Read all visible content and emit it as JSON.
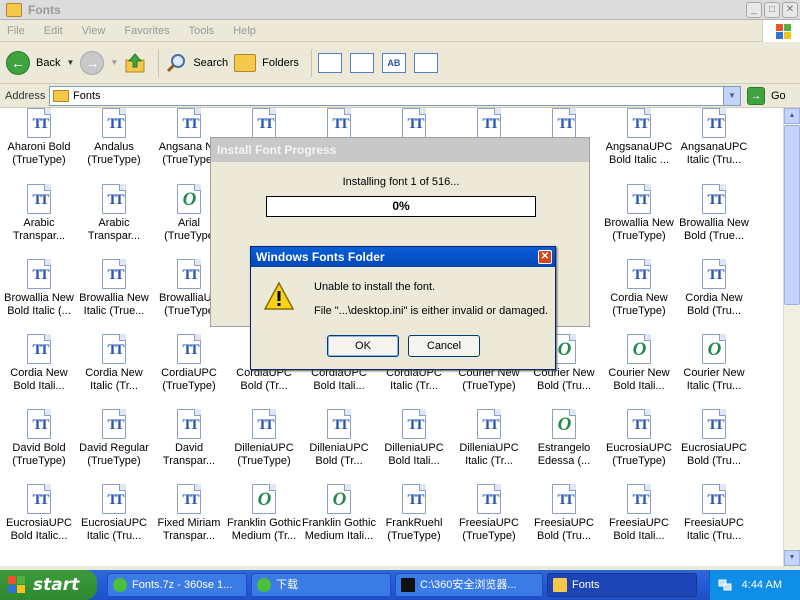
{
  "window": {
    "title": "Fonts",
    "buttons": {
      "minimize": "_",
      "maximize": "□",
      "close": "✕"
    }
  },
  "menu": [
    "File",
    "Edit",
    "View",
    "Favorites",
    "Tools",
    "Help"
  ],
  "toolbar": {
    "back_label": "Back",
    "search_label": "Search",
    "folders_label": "Folders",
    "views": [
      "thumbnails-view",
      "large-icons-view",
      "details-view",
      "list-view"
    ],
    "view_glyphs": [
      "",
      "",
      "AB",
      ""
    ]
  },
  "address": {
    "label": "Address",
    "value": "Fonts",
    "go_label": "Go"
  },
  "fonts": [
    {
      "name": "Aharoni Bold",
      "type": "(TrueType)",
      "kind": "tt"
    },
    {
      "name": "Andalus",
      "type": "(TrueType)",
      "kind": "tt"
    },
    {
      "name": "Angsana Ne",
      "type": "(TrueType)",
      "kind": "tt"
    },
    {
      "name": "",
      "type": "",
      "kind": "tt"
    },
    {
      "name": "",
      "type": "",
      "kind": "tt"
    },
    {
      "name": "",
      "type": "",
      "kind": "tt"
    },
    {
      "name": "",
      "type": "",
      "kind": "tt"
    },
    {
      "name": "UPC",
      "type": "",
      "kind": "tt"
    },
    {
      "name": "AngsanaUPC",
      "type": "Bold Italic ...",
      "kind": "tt"
    },
    {
      "name": "AngsanaUPC",
      "type": "Italic (Tru...",
      "kind": "tt"
    },
    {
      "name": "Arabic",
      "type": "Transpar...",
      "kind": "tt"
    },
    {
      "name": "Arabic",
      "type": "Transpar...",
      "kind": "tt"
    },
    {
      "name": "Arial",
      "type": "(TrueType",
      "kind": "ot"
    },
    {
      "name": "",
      "type": "",
      "kind": "tt"
    },
    {
      "name": "",
      "type": "",
      "kind": "tt"
    },
    {
      "name": "",
      "type": "",
      "kind": "tt"
    },
    {
      "name": "",
      "type": "",
      "kind": "tt"
    },
    {
      "name": "",
      "type": "",
      "kind": "tt"
    },
    {
      "name": "Browallia New",
      "type": "(TrueType)",
      "kind": "tt"
    },
    {
      "name": "Browallia New",
      "type": "Bold (True...",
      "kind": "tt"
    },
    {
      "name": "Browallia New",
      "type": "Bold Italic (...",
      "kind": "tt"
    },
    {
      "name": "Browallia New",
      "type": "Italic (True...",
      "kind": "tt"
    },
    {
      "name": "BrowalliaUP",
      "type": "(TrueType",
      "kind": "tt"
    },
    {
      "name": "",
      "type": "",
      "kind": "tt"
    },
    {
      "name": "",
      "type": "",
      "kind": "tt"
    },
    {
      "name": "",
      "type": "",
      "kind": "tt"
    },
    {
      "name": "",
      "type": "",
      "kind": "tt"
    },
    {
      "name": "MS",
      "type": "",
      "kind": "tt"
    },
    {
      "name": "Cordia New",
      "type": "(TrueType)",
      "kind": "tt"
    },
    {
      "name": "Cordia New",
      "type": "Bold (Tru...",
      "kind": "tt"
    },
    {
      "name": "Cordia New",
      "type": "Bold Itali...",
      "kind": "tt"
    },
    {
      "name": "Cordia New",
      "type": "Italic (Tr...",
      "kind": "tt"
    },
    {
      "name": "CordiaUPC",
      "type": "(TrueType)",
      "kind": "tt"
    },
    {
      "name": "CordiaUPC",
      "type": "Bold (Tr...",
      "kind": "tt"
    },
    {
      "name": "CordiaUPC",
      "type": "Bold Itali...",
      "kind": "tt"
    },
    {
      "name": "CordiaUPC",
      "type": "Italic (Tr...",
      "kind": "tt"
    },
    {
      "name": "Courier New",
      "type": "(TrueType)",
      "kind": "ot"
    },
    {
      "name": "Courier New",
      "type": "Bold (Tru...",
      "kind": "ot"
    },
    {
      "name": "Courier New",
      "type": "Bold Itali...",
      "kind": "ot"
    },
    {
      "name": "Courier New",
      "type": "Italic (Tru...",
      "kind": "ot"
    },
    {
      "name": "David Bold",
      "type": "(TrueType)",
      "kind": "tt"
    },
    {
      "name": "David Regular",
      "type": "(TrueType)",
      "kind": "tt"
    },
    {
      "name": "David",
      "type": "Transpar...",
      "kind": "tt"
    },
    {
      "name": "DilleniaUPC",
      "type": "(TrueType)",
      "kind": "tt"
    },
    {
      "name": "DilleniaUPC",
      "type": "Bold (Tr...",
      "kind": "tt"
    },
    {
      "name": "DilleniaUPC",
      "type": "Bold Itali...",
      "kind": "tt"
    },
    {
      "name": "DilleniaUPC",
      "type": "Italic (Tr...",
      "kind": "tt"
    },
    {
      "name": "Estrangelo",
      "type": "Edessa (...",
      "kind": "ot"
    },
    {
      "name": "EucrosiaUPC",
      "type": "(TrueType)",
      "kind": "tt"
    },
    {
      "name": "EucrosiaUPC",
      "type": "Bold (Tru...",
      "kind": "tt"
    },
    {
      "name": "EucrosiaUPC",
      "type": "Bold Italic...",
      "kind": "tt"
    },
    {
      "name": "EucrosiaUPC",
      "type": "Italic (Tru...",
      "kind": "tt"
    },
    {
      "name": "Fixed Miriam",
      "type": "Transpar...",
      "kind": "tt"
    },
    {
      "name": "Franklin Gothic",
      "type": "Medium (Tr...",
      "kind": "ot"
    },
    {
      "name": "Franklin Gothic",
      "type": "Medium Itali...",
      "kind": "ot"
    },
    {
      "name": "FrankRuehl",
      "type": "(TrueType)",
      "kind": "tt"
    },
    {
      "name": "FreesiaUPC",
      "type": "(TrueType)",
      "kind": "tt"
    },
    {
      "name": "FreesiaUPC",
      "type": "Bold (Tru...",
      "kind": "tt"
    },
    {
      "name": "FreesiaUPC",
      "type": "Bold Itali...",
      "kind": "tt"
    },
    {
      "name": "FreesiaUPC",
      "type": "Italic (Tru...",
      "kind": "tt"
    }
  ],
  "progress_dialog": {
    "title": "Install Font Progress",
    "text": "Installing font 1 of 516...",
    "percent_label": "0%",
    "percent": 0
  },
  "error_dialog": {
    "title": "Windows Fonts Folder",
    "close": "✕",
    "line1": "Unable to install the font.",
    "line2": "File \"...\\desktop.ini\" is either invalid or damaged.",
    "ok_label": "OK",
    "cancel_label": "Cancel"
  },
  "taskbar": {
    "start_label": "start",
    "tasks": [
      {
        "label": "Fonts.7z - 360se 1...",
        "icon": "360se-icon",
        "active": false
      },
      {
        "label": "下载",
        "icon": "360se-icon",
        "active": false
      },
      {
        "label": "C:\\360安全浏览器...",
        "icon": "7zip-icon",
        "active": false
      },
      {
        "label": "Fonts",
        "icon": "folder-icon",
        "active": true
      }
    ],
    "clock": "4:44 AM"
  },
  "colors": {
    "taskbar_blue": "#245ddb",
    "start_green": "#2f8a2f",
    "dialog_title_blue": "#0047b8",
    "truetype_blue": "#2a56b0",
    "opentype_green": "#1f8a4c"
  }
}
